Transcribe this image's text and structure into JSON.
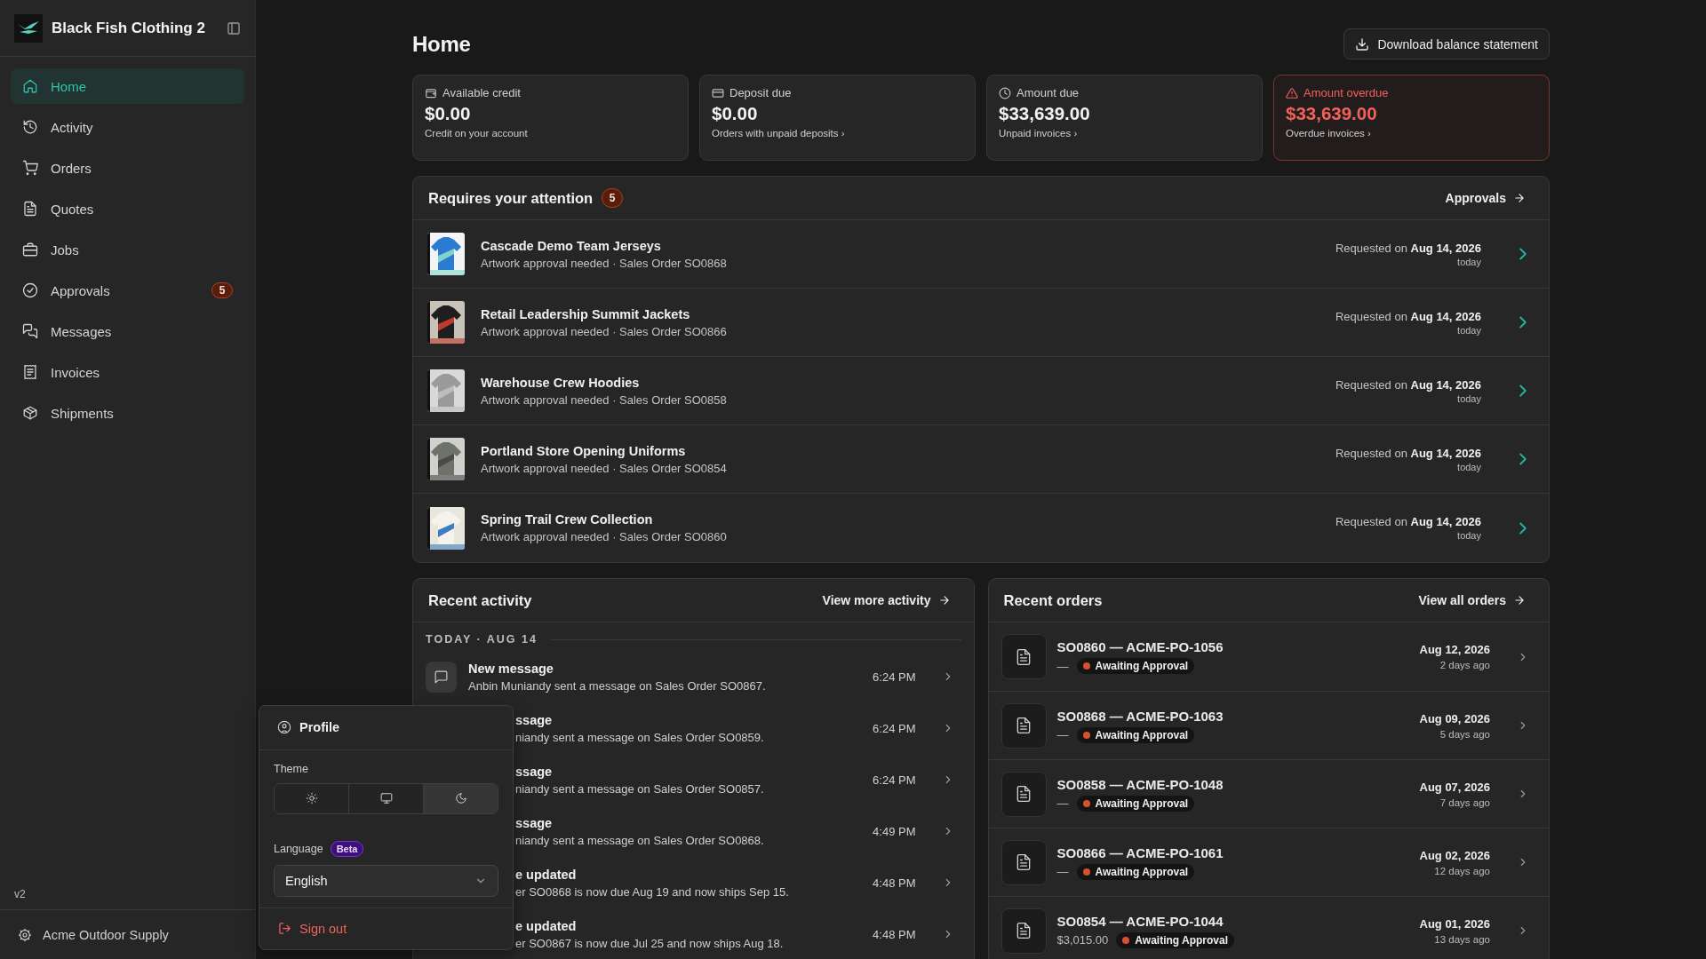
{
  "sidebar": {
    "brand": "Black Fish Clothing 2",
    "items": [
      {
        "label": "Home",
        "selected": true
      },
      {
        "label": "Activity",
        "selected": false
      },
      {
        "label": "Orders",
        "selected": false
      },
      {
        "label": "Quotes",
        "selected": false
      },
      {
        "label": "Jobs",
        "selected": false
      },
      {
        "label": "Approvals",
        "selected": false,
        "badge": "5"
      },
      {
        "label": "Messages",
        "selected": false
      },
      {
        "label": "Invoices",
        "selected": false
      },
      {
        "label": "Shipments",
        "selected": false
      }
    ],
    "version": "v2",
    "account": "Acme Outdoor Supply"
  },
  "page": {
    "title": "Home",
    "download_button": "Download balance statement"
  },
  "summary_cards": [
    {
      "label": "Available credit",
      "amount": "$0.00",
      "note": "Credit on your account",
      "alert": false
    },
    {
      "label": "Deposit due",
      "amount": "$0.00",
      "note": "Orders with unpaid deposits ›",
      "alert": false
    },
    {
      "label": "Amount due",
      "amount": "$33,639.00",
      "note": "Unpaid invoices ›",
      "alert": false
    },
    {
      "label": "Amount overdue",
      "amount": "$33,639.00",
      "note": "Overdue invoices ›",
      "alert": true
    }
  ],
  "attention": {
    "title": "Requires your attention",
    "count": "5",
    "link": "Approvals",
    "items": [
      {
        "title": "Cascade Demo Team Jerseys",
        "subtitle": "Artwork approval needed · Sales Order SO0868",
        "requested": "Requested on **Aug 14, 2026**",
        "relative": "today"
      },
      {
        "title": "Retail Leadership Summit Jackets",
        "subtitle": "Artwork approval needed · Sales Order SO0866",
        "requested": "Requested on **Aug 14, 2026**",
        "relative": "today"
      },
      {
        "title": "Warehouse Crew Hoodies",
        "subtitle": "Artwork approval needed · Sales Order SO0858",
        "requested": "Requested on **Aug 14, 2026**",
        "relative": "today"
      },
      {
        "title": "Portland Store Opening Uniforms",
        "subtitle": "Artwork approval needed · Sales Order SO0854",
        "requested": "Requested on **Aug 14, 2026**",
        "relative": "today"
      },
      {
        "title": "Spring Trail Crew Collection",
        "subtitle": "Artwork approval needed · Sales Order SO0860",
        "requested": "Requested on **Aug 14, 2026**",
        "relative": "today"
      }
    ]
  },
  "recent_activity": {
    "title": "Recent activity",
    "link": "View more activity",
    "day": "TODAY · AUG 14",
    "items": [
      {
        "title": "New message",
        "detail": "Anbin Muniandy sent a message on Sales Order SO0867.",
        "time": "6:24 PM",
        "covered": false
      },
      {
        "title": "ssage",
        "detail": "niandy sent a message on Sales Order SO0859.",
        "time": "6:24 PM",
        "covered": true
      },
      {
        "title": "ssage",
        "detail": "niandy sent a message on Sales Order SO0857.",
        "time": "6:24 PM",
        "covered": true
      },
      {
        "title": "ssage",
        "detail": "niandy sent a message on Sales Order SO0868.",
        "time": "4:49 PM",
        "covered": true
      },
      {
        "title": "e updated",
        "detail": "er SO0868 is now due Aug 19 and now ships Sep 15.",
        "time": "4:48 PM",
        "covered": true
      },
      {
        "title": "e updated",
        "detail": "er SO0867 is now due Jul 25 and now ships Aug 18.",
        "time": "4:48 PM",
        "covered": true
      }
    ]
  },
  "recent_orders": {
    "title": "Recent orders",
    "link": "View all orders",
    "items": [
      {
        "title": "SO0860 — ACME-PO-1056",
        "amount": "—",
        "status": "Awaiting Approval",
        "date": "Aug 12, 2026",
        "relative": "2 days ago"
      },
      {
        "title": "SO0868 — ACME-PO-1063",
        "amount": "—",
        "status": "Awaiting Approval",
        "date": "Aug 09, 2026",
        "relative": "5 days ago"
      },
      {
        "title": "SO0858 — ACME-PO-1048",
        "amount": "—",
        "status": "Awaiting Approval",
        "date": "Aug 07, 2026",
        "relative": "7 days ago"
      },
      {
        "title": "SO0866 — ACME-PO-1061",
        "amount": "—",
        "status": "Awaiting Approval",
        "date": "Aug 02, 2026",
        "relative": "12 days ago"
      },
      {
        "title": "SO0854 — ACME-PO-1044",
        "amount": "$3,015.00",
        "status": "Awaiting Approval",
        "date": "Aug 01, 2026",
        "relative": "13 days ago"
      }
    ]
  },
  "profile_menu": {
    "title": "Profile",
    "theme_label": "Theme",
    "theme_options": [
      {
        "selected": false
      },
      {
        "selected": false
      },
      {
        "selected": true
      }
    ],
    "language_label": "Language",
    "language_badge": "Beta",
    "language": {
      "value": "English"
    },
    "sign_out": "Sign out"
  }
}
